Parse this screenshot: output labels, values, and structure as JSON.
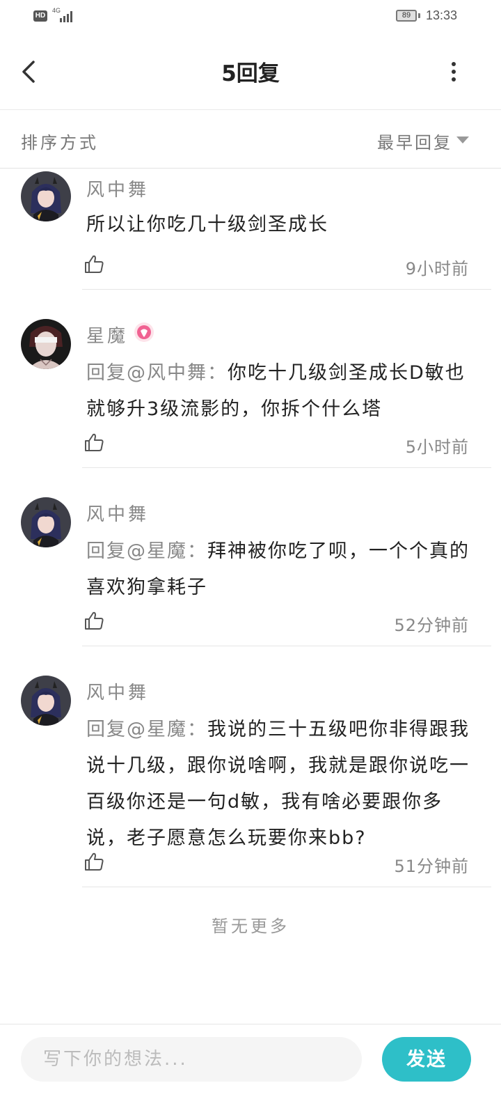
{
  "status_bar": {
    "hd": "HD",
    "network": "4G",
    "battery": "89",
    "time": "13:33"
  },
  "header": {
    "title": "5回复",
    "back_icon": "chevron-left-icon",
    "more_icon": "more-vertical-icon"
  },
  "sort": {
    "label": "排序方式",
    "selected": "最早回复"
  },
  "replies": [
    {
      "author": "风中舞",
      "mention": "",
      "text": "所以让你吃几十级剑圣成长",
      "time": "9小时前"
    },
    {
      "author": "星魔",
      "mention": "回复@风中舞：",
      "text": "你吃十几级剑圣成长D敏也就够升3级流影的，你拆个什么塔",
      "time": "5小时前"
    },
    {
      "author": "风中舞",
      "mention": "回复@星魔：",
      "text": "拜神被你吃了呗，一个个真的喜欢狗拿耗子",
      "time": "52分钟前"
    },
    {
      "author": "风中舞",
      "mention": "回复@星魔：",
      "text": "我说的三十五级吧你非得跟我说十几级，跟你说啥啊，我就是跟你说吃一百级你还是一句d敏，我有啥必要跟你多说，老子愿意怎么玩要你来bb?",
      "time": "51分钟前"
    }
  ],
  "footer_note": "暂无更多",
  "composer": {
    "placeholder": "写下你的想法...",
    "send_label": "发送"
  },
  "colors": {
    "accent": "#2ebfc8",
    "muted_text": "#888888",
    "vip_pink": "#f06292"
  }
}
